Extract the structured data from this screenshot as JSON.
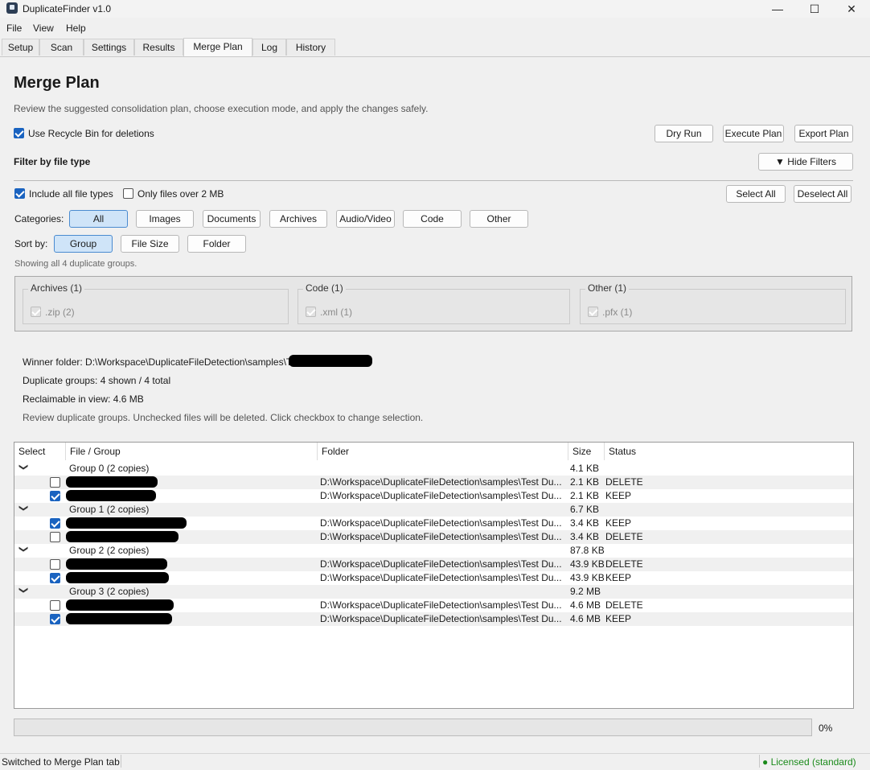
{
  "window": {
    "title": "DuplicateFinder v1.0",
    "minimize": "—",
    "maximize": "☐",
    "close": "✕"
  },
  "menu": [
    "File",
    "View",
    "Help"
  ],
  "tabs": [
    "Setup",
    "Scan",
    "Settings",
    "Results",
    "Merge Plan",
    "Log",
    "History"
  ],
  "active_tab": "Merge Plan",
  "page": {
    "title": "Merge Plan",
    "description": "Review the suggested consolidation plan, choose execution mode, and apply the changes safely."
  },
  "options": {
    "recycle_bin_label": "Use Recycle Bin for deletions",
    "recycle_bin_checked": true
  },
  "actions": {
    "dry_run": "Dry Run",
    "execute": "Execute Plan",
    "export": "Export Plan"
  },
  "filter": {
    "heading": "Filter by file type",
    "hide_filters": "▼ Hide Filters",
    "include_all_label": "Include all file types",
    "include_all_checked": true,
    "over_2mb_label": "Only files over 2 MB",
    "over_2mb_checked": false,
    "select_all": "Select All",
    "deselect_all": "Deselect All",
    "categories_label": "Categories:",
    "categories": [
      "All",
      "Images",
      "Documents",
      "Archives",
      "Audio/Video",
      "Code",
      "Other"
    ],
    "selected_category": "All",
    "sort_label": "Sort by:",
    "sort_options": [
      "Group",
      "File Size",
      "Folder"
    ],
    "selected_sort": "Group",
    "showing": "Showing all 4 duplicate groups.",
    "groups": [
      {
        "title": "Archives (1)",
        "ext": ".zip (2)"
      },
      {
        "title": "Code (1)",
        "ext": ".xml (1)"
      },
      {
        "title": "Other (1)",
        "ext": ".pfx (1)"
      }
    ]
  },
  "summary": {
    "winner_folder": "Winner folder: D:\\Workspace\\DuplicateFileDetection\\samples\\T",
    "duplicate_groups": "Duplicate groups: 4 shown / 4 total",
    "reclaimable": "Reclaimable in view: 4.6 MB",
    "hint": "Review duplicate groups. Unchecked files will be deleted. Click checkbox to change selection."
  },
  "table": {
    "columns": [
      "Select",
      "File / Group",
      "Folder",
      "Size",
      "Status"
    ],
    "groups": [
      {
        "label": "Group 0 (2 copies)",
        "size": "4.1 KB",
        "files": [
          {
            "checked": false,
            "folder": "D:\\Workspace\\DuplicateFileDetection\\samples\\Test Du...",
            "size": "2.1 KB",
            "status": "DELETE"
          },
          {
            "checked": true,
            "folder": "D:\\Workspace\\DuplicateFileDetection\\samples\\Test Du...",
            "size": "2.1 KB",
            "status": "KEEP"
          }
        ]
      },
      {
        "label": "Group 1 (2 copies)",
        "size": "6.7 KB",
        "files": [
          {
            "checked": true,
            "folder": "D:\\Workspace\\DuplicateFileDetection\\samples\\Test Du...",
            "size": "3.4 KB",
            "status": "KEEP"
          },
          {
            "checked": false,
            "folder": "D:\\Workspace\\DuplicateFileDetection\\samples\\Test Du...",
            "size": "3.4 KB",
            "status": "DELETE"
          }
        ]
      },
      {
        "label": "Group 2 (2 copies)",
        "size": "87.8 KB",
        "files": [
          {
            "checked": false,
            "folder": "D:\\Workspace\\DuplicateFileDetection\\samples\\Test Du...",
            "size": "43.9 KB",
            "status": "DELETE"
          },
          {
            "checked": true,
            "folder": "D:\\Workspace\\DuplicateFileDetection\\samples\\Test Du...",
            "size": "43.9 KB",
            "status": "KEEP"
          }
        ]
      },
      {
        "label": "Group 3 (2 copies)",
        "size": "9.2 MB",
        "files": [
          {
            "checked": false,
            "folder": "D:\\Workspace\\DuplicateFileDetection\\samples\\Test Du...",
            "size": "4.6 MB",
            "status": "DELETE"
          },
          {
            "checked": true,
            "folder": "D:\\Workspace\\DuplicateFileDetection\\samples\\Test Du...",
            "size": "4.6 MB",
            "status": "KEEP"
          }
        ]
      }
    ]
  },
  "progress": {
    "value": 0,
    "text": "0%"
  },
  "status": {
    "message": "Switched to Merge Plan tab",
    "license": "● Licensed (standard)"
  }
}
